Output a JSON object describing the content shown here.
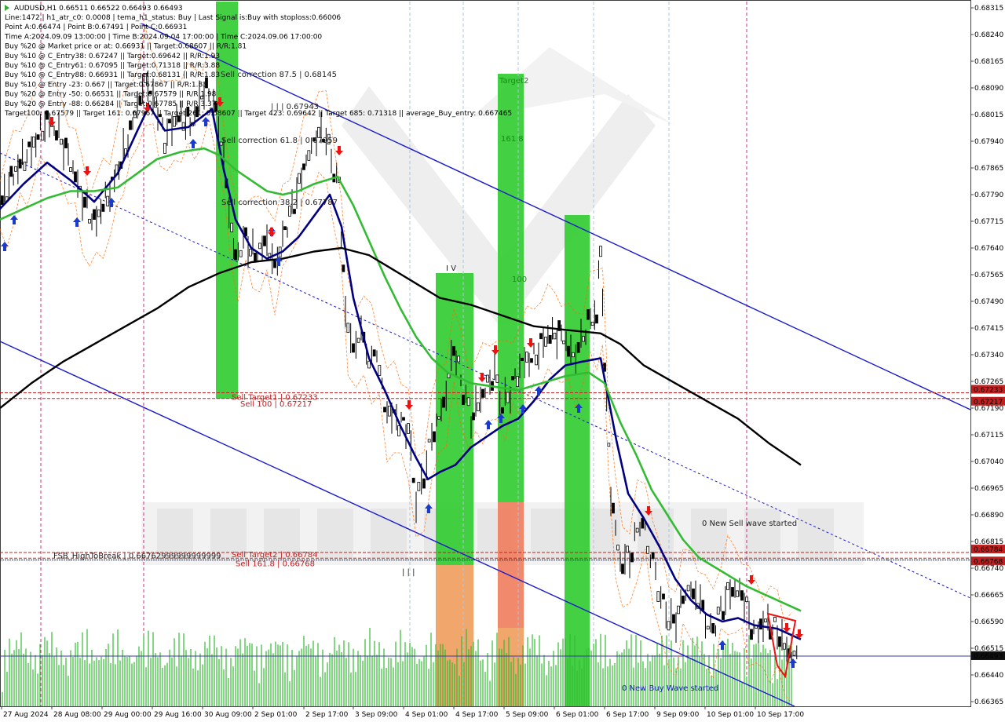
{
  "chart_data": {
    "type": "line",
    "symbol": "AUDUSD,H1",
    "header": "AUDUSD,H1  0.66511 0.66522 0.66493 0.66493",
    "info_lines": [
      "Line:1472 | h1_atr_c0: 0.0008 | tema_h1_status: Buy | Last Signal is:Buy with stoploss:0.66006",
      "Point A:0.66474 | Point B:0.67491 | Point C:0.66931",
      "Time A:2024.09.09 13:00:00 | Time B:2024.09.04 17:00:00 | Time C:2024.09.06 17:00:00",
      "Buy %20 @ Market price or at: 0.66931 || Target:0.68607 || R/R:1.81",
      "Buy %10 @ C_Entry38: 0.67247 || Target:0.69642 || R/R:1.93",
      "Buy %10 @ C_Entry61: 0.67095 || Target:0.71318 || R/R:3.88",
      "Buy %10 @ C_Entry88: 0.66931 || Target:0.68131 || R/R:1.83",
      "Buy %10 @ Entry -23: 0.667 || Target:0.67867 || R/R:1.83",
      "Buy %20 @ Entry -50: 0.66531 || Target:0.67579 || R/R:1.98",
      "Buy %20 @ Entry -88: 0.66284 || Target:0.67785 || R/R:3.37",
      "Target100: 0.67579 || Target 161: 0.67967 || Target 261: 0.68607 || Target 423: 0.69642 || Target 685: 0.71318 || average_Buy_entry: 0.667465"
    ],
    "price_axis": {
      "min": 0.66365,
      "max": 0.68315,
      "ticks": [
        "0.68315",
        "0.68240",
        "0.68165",
        "0.68090",
        "0.68015",
        "0.67940",
        "0.67865",
        "0.67790",
        "0.67715",
        "0.67640",
        "0.67565",
        "0.67490",
        "0.67415",
        "0.67340",
        "0.67265",
        "0.67190",
        "0.67115",
        "0.67040",
        "0.66965",
        "0.66890",
        "0.66815",
        "0.66740",
        "0.66665",
        "0.66590",
        "0.66515",
        "0.66440",
        "0.66365"
      ],
      "highlight_labels": [
        {
          "text": "0.67233",
          "value": 0.67233,
          "color": "#c22020"
        },
        {
          "text": "0.67217",
          "value": 0.67217,
          "color": "#c22020"
        },
        {
          "text": "0.66784",
          "value": 0.66784,
          "color": "#c22020"
        },
        {
          "text": "0.66768",
          "value": 0.66768,
          "color": "#c22020"
        },
        {
          "text": "0.66493",
          "value": 0.66493,
          "color": "#101010"
        }
      ]
    },
    "time_axis": {
      "labels": [
        "27 Aug 2024",
        "28 Aug 08:00",
        "29 Aug 00:00",
        "29 Aug 16:00",
        "30 Aug 09:00",
        "2 Sep 01:00",
        "2 Sep 17:00",
        "3 Sep 09:00",
        "4 Sep 01:00",
        "4 Sep 17:00",
        "5 Sep 09:00",
        "6 Sep 01:00",
        "6 Sep 17:00",
        "9 Sep 09:00",
        "10 Sep 01:00",
        "10 Sep 17:00"
      ]
    },
    "levels": [
      {
        "label": "Sell Target1 | 0.67233",
        "value": 0.67233,
        "color": "#c22020"
      },
      {
        "label": "Sell 100 | 0.67217",
        "value": 0.67217,
        "color": "#c22020"
      },
      {
        "label": "Sell Target2 | 0.66784",
        "value": 0.66784,
        "color": "#c22020"
      },
      {
        "label": "Sell 161.8 | 0.66768",
        "value": 0.66768,
        "color": "#c22020"
      },
      {
        "label": "FSB_HighToBreak | 0.66762999999999999",
        "value": 0.66763,
        "color": "#1a1aa0"
      },
      {
        "label": "",
        "value": 0.66493,
        "color": "#3a3aa0"
      }
    ],
    "annotations": [
      {
        "text": "Sell correction 87.5 | 0.68145",
        "value": 0.68145
      },
      {
        "text": "| | | 0.67943",
        "value": 0.67943
      },
      {
        "text": "Sell correction 61.8 | 0.67959",
        "value": 0.67959
      },
      {
        "text": "Sell correction 38.2 | 0.67787",
        "value": 0.67787
      },
      {
        "text": "I V",
        "value": 0.6759
      },
      {
        "text": "Target2",
        "value": 0.6822
      },
      {
        "text": "161.8",
        "value": 0.6798
      },
      {
        "text": "100",
        "value": 0.6754
      },
      {
        "text": "| | |",
        "value": 0.6674
      },
      {
        "text": "0 New Sell wave started",
        "value": 0.6687
      },
      {
        "text": "0 New Buy Wave started",
        "value": 0.6642
      }
    ],
    "series": [
      {
        "name": "",
        "color": "#000080",
        "points": [
          [
            0,
            0.6775
          ],
          [
            30,
            0.6782
          ],
          [
            60,
            0.6788
          ],
          [
            90,
            0.6783
          ],
          [
            120,
            0.6777
          ],
          [
            150,
            0.6785
          ],
          [
            175,
            0.6797
          ],
          [
            190,
            0.6804
          ],
          [
            210,
            0.6797
          ],
          [
            240,
            0.6798
          ],
          [
            270,
            0.6803
          ],
          [
            285,
            0.6786
          ],
          [
            300,
            0.6772
          ],
          [
            320,
            0.6764
          ],
          [
            340,
            0.6761
          ],
          [
            360,
            0.6763
          ],
          [
            380,
            0.6767
          ],
          [
            400,
            0.6773
          ],
          [
            420,
            0.6779
          ],
          [
            435,
            0.677
          ],
          [
            450,
            0.675
          ],
          [
            470,
            0.6733
          ],
          [
            490,
            0.6724
          ],
          [
            510,
            0.6714
          ],
          [
            530,
            0.6705
          ],
          [
            545,
            0.6699
          ],
          [
            560,
            0.6701
          ],
          [
            580,
            0.6703
          ],
          [
            600,
            0.6708
          ],
          [
            620,
            0.6711
          ],
          [
            640,
            0.6714
          ],
          [
            660,
            0.6716
          ],
          [
            680,
            0.6721
          ],
          [
            700,
            0.6727
          ],
          [
            720,
            0.6731
          ],
          [
            740,
            0.6732
          ],
          [
            765,
            0.6733
          ],
          [
            785,
            0.671
          ],
          [
            800,
            0.6695
          ],
          [
            820,
            0.6688
          ],
          [
            840,
            0.668
          ],
          [
            860,
            0.6671
          ],
          [
            880,
            0.6665
          ],
          [
            900,
            0.6661
          ],
          [
            920,
            0.6659
          ],
          [
            940,
            0.666
          ],
          [
            960,
            0.6658
          ],
          [
            990,
            0.6657
          ],
          [
            1020,
            0.6654
          ]
        ]
      },
      {
        "name": "",
        "color": "#33bb33",
        "points": [
          [
            0,
            0.6772
          ],
          [
            30,
            0.6775
          ],
          [
            60,
            0.6778
          ],
          [
            90,
            0.678
          ],
          [
            120,
            0.678
          ],
          [
            150,
            0.6781
          ],
          [
            175,
            0.6785
          ],
          [
            200,
            0.6789
          ],
          [
            230,
            0.6791
          ],
          [
            260,
            0.6792
          ],
          [
            280,
            0.679
          ],
          [
            300,
            0.6786
          ],
          [
            320,
            0.6783
          ],
          [
            340,
            0.678
          ],
          [
            360,
            0.6779
          ],
          [
            380,
            0.678
          ],
          [
            400,
            0.6782
          ],
          [
            430,
            0.6784
          ],
          [
            450,
            0.6776
          ],
          [
            470,
            0.6766
          ],
          [
            490,
            0.6756
          ],
          [
            510,
            0.6747
          ],
          [
            530,
            0.6739
          ],
          [
            550,
            0.6733
          ],
          [
            570,
            0.6729
          ],
          [
            600,
            0.6726
          ],
          [
            630,
            0.6725
          ],
          [
            660,
            0.6724
          ],
          [
            690,
            0.6726
          ],
          [
            720,
            0.6728
          ],
          [
            750,
            0.6729
          ],
          [
            770,
            0.6726
          ],
          [
            790,
            0.6715
          ],
          [
            810,
            0.6706
          ],
          [
            830,
            0.6696
          ],
          [
            850,
            0.6689
          ],
          [
            870,
            0.6682
          ],
          [
            890,
            0.6677
          ],
          [
            920,
            0.6673
          ],
          [
            950,
            0.6669
          ],
          [
            980,
            0.6666
          ],
          [
            1020,
            0.6662
          ]
        ]
      },
      {
        "name": "",
        "color": "#000000",
        "points": [
          [
            0,
            0.6719
          ],
          [
            40,
            0.6726
          ],
          [
            80,
            0.6732
          ],
          [
            120,
            0.6737
          ],
          [
            160,
            0.6742
          ],
          [
            200,
            0.6747
          ],
          [
            240,
            0.6753
          ],
          [
            280,
            0.6757
          ],
          [
            320,
            0.676
          ],
          [
            360,
            0.6761
          ],
          [
            400,
            0.6763
          ],
          [
            435,
            0.6764
          ],
          [
            470,
            0.6762
          ],
          [
            500,
            0.6758
          ],
          [
            530,
            0.6754
          ],
          [
            560,
            0.675
          ],
          [
            600,
            0.6748
          ],
          [
            640,
            0.6745
          ],
          [
            680,
            0.6742
          ],
          [
            720,
            0.6741
          ],
          [
            765,
            0.674
          ],
          [
            790,
            0.6737
          ],
          [
            820,
            0.6731
          ],
          [
            860,
            0.6726
          ],
          [
            900,
            0.6721
          ],
          [
            940,
            0.6716
          ],
          [
            980,
            0.6709
          ],
          [
            1020,
            0.6703
          ]
        ]
      }
    ],
    "price_path": [
      [
        0,
        0.6776
      ],
      [
        20,
        0.6786
      ],
      [
        40,
        0.6792
      ],
      [
        60,
        0.68
      ],
      [
        75,
        0.6796
      ],
      [
        90,
        0.6788
      ],
      [
        105,
        0.6778
      ],
      [
        120,
        0.6771
      ],
      [
        140,
        0.678
      ],
      [
        160,
        0.6792
      ],
      [
        175,
        0.6804
      ],
      [
        185,
        0.6811
      ],
      [
        195,
        0.6807
      ],
      [
        210,
        0.6795
      ],
      [
        225,
        0.6801
      ],
      [
        245,
        0.6799
      ],
      [
        260,
        0.6809
      ],
      [
        275,
        0.6803
      ],
      [
        285,
        0.6789
      ],
      [
        295,
        0.6769
      ],
      [
        300,
        0.676
      ],
      [
        310,
        0.6767
      ],
      [
        325,
        0.6762
      ],
      [
        340,
        0.6766
      ],
      [
        350,
        0.6758
      ],
      [
        360,
        0.6767
      ],
      [
        375,
        0.6777
      ],
      [
        390,
        0.6789
      ],
      [
        400,
        0.6794
      ],
      [
        412,
        0.6797
      ],
      [
        422,
        0.6789
      ],
      [
        432,
        0.6781
      ],
      [
        440,
        0.6746
      ],
      [
        450,
        0.6735
      ],
      [
        460,
        0.6741
      ],
      [
        470,
        0.6732
      ],
      [
        480,
        0.6735
      ],
      [
        490,
        0.6719
      ],
      [
        505,
        0.6716
      ],
      [
        520,
        0.6713
      ],
      [
        530,
        0.6693
      ],
      [
        540,
        0.67
      ],
      [
        550,
        0.6711
      ],
      [
        565,
        0.672
      ],
      [
        578,
        0.6736
      ],
      [
        590,
        0.6724
      ],
      [
        600,
        0.6716
      ],
      [
        615,
        0.6723
      ],
      [
        630,
        0.6729
      ],
      [
        640,
        0.6719
      ],
      [
        650,
        0.6724
      ],
      [
        665,
        0.6732
      ],
      [
        680,
        0.6733
      ],
      [
        695,
        0.6739
      ],
      [
        715,
        0.674
      ],
      [
        730,
        0.6733
      ],
      [
        740,
        0.6738
      ],
      [
        752,
        0.6744
      ],
      [
        760,
        0.6745
      ],
      [
        765,
        0.6765
      ],
      [
        770,
        0.6732
      ],
      [
        778,
        0.6695
      ],
      [
        790,
        0.6675
      ],
      [
        805,
        0.6678
      ],
      [
        815,
        0.6688
      ],
      [
        825,
        0.6681
      ],
      [
        835,
        0.6672
      ],
      [
        845,
        0.6663
      ],
      [
        858,
        0.6658
      ],
      [
        870,
        0.6666
      ],
      [
        880,
        0.6668
      ],
      [
        892,
        0.6664
      ],
      [
        905,
        0.6656
      ],
      [
        918,
        0.6662
      ],
      [
        930,
        0.6668
      ],
      [
        945,
        0.6667
      ],
      [
        960,
        0.6656
      ],
      [
        975,
        0.6659
      ],
      [
        990,
        0.6656
      ],
      [
        1005,
        0.665
      ],
      [
        1018,
        0.6649
      ]
    ]
  }
}
